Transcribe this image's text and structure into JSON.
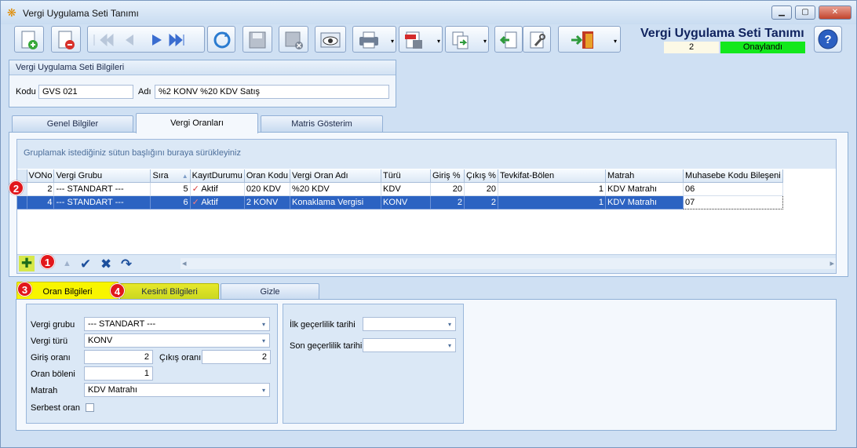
{
  "window": {
    "title": "Vergi Uygulama Seti Tanımı",
    "min": "▁",
    "max": "▢",
    "close": "✕"
  },
  "header": {
    "title": "Vergi Uygulama Seti Tanımı",
    "number": "2",
    "status": "Onaylandı",
    "status_color": "#13e81c"
  },
  "group": {
    "title": "Vergi Uygulama Seti Bilgileri",
    "kodu_label": "Kodu",
    "kodu_value": "GVS 021",
    "adi_label": "Adı",
    "adi_value": "%2 KONV %20 KDV Satış"
  },
  "tabs": [
    "Genel Bilgiler",
    "Vergi Oranları",
    "Matris Gösterim"
  ],
  "grid": {
    "group_hint": "Gruplamak istediğiniz sütun başlığını buraya sürükleyiniz",
    "columns": [
      "VONo",
      "Vergi Grubu",
      "Sıra",
      "KayıtDurumu",
      "Oran Kodu",
      "Vergi Oran Adı",
      "Türü",
      "Giriş %",
      "Çıkış %",
      "Tevkifat-Bölen",
      "Matrah",
      "Muhasebe Kodu Bileşeni"
    ],
    "rows": [
      [
        "2",
        "--- STANDART ---",
        "5",
        "Aktif",
        "020 KDV",
        "%20 KDV",
        "KDV",
        "20",
        "20",
        "1",
        "KDV Matrahı",
        "06"
      ],
      [
        "4",
        "--- STANDART ---",
        "6",
        "Aktif",
        "2 KONV",
        "Konaklama Vergisi",
        "KONV",
        "2",
        "2",
        "1",
        "KDV Matrahı",
        "07"
      ]
    ],
    "sort_icon": "▲",
    "row_cursor": "I",
    "check_mark": "✓"
  },
  "nav": {
    "add": "✚",
    "up": "▲",
    "save": "✔",
    "cancel": "✖",
    "refresh": "↷",
    "scroll_left": "◂",
    "scroll_right": "▸"
  },
  "badges": [
    "1",
    "2",
    "3",
    "4"
  ],
  "bottom_tabs": [
    "Oran Bilgileri",
    "Kesinti Bilgileri",
    "Gizle"
  ],
  "form": {
    "vergi_grubu_label": "Vergi grubu",
    "vergi_grubu_value": "--- STANDART ---",
    "vergi_turu_label": "Vergi türü",
    "vergi_turu_value": "KONV",
    "giris_label": "Giriş oranı",
    "giris_value": "2",
    "cikis_label": "Çıkış oranı",
    "cikis_value": "2",
    "oran_boleni_label": "Oran böleni",
    "oran_boleni_value": "1",
    "matrah_label": "Matrah",
    "matrah_value": "KDV Matrahı",
    "serbest_label": "Serbest oran",
    "ilk_label": "İlk geçerlilik tarihi",
    "ilk_value": "",
    "son_label": "Son geçerlilik tarihi",
    "son_value": "",
    "dropdown_arrow": "▾"
  }
}
